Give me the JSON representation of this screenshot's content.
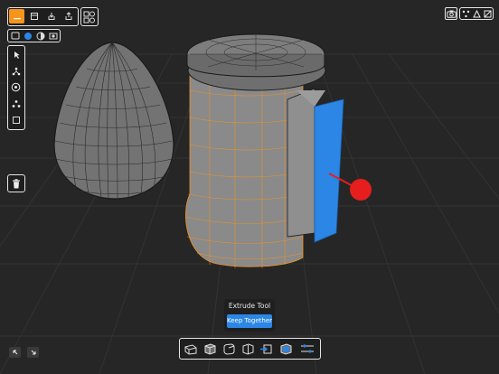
{
  "app": {
    "accent_color": "#f7941d",
    "selection_color": "#2b86e6",
    "marker_color": "#e61e1e"
  },
  "top_left_toolbar": {
    "items": [
      {
        "icon": "menu-icon",
        "active": true
      },
      {
        "icon": "save-icon",
        "active": false
      },
      {
        "icon": "import-icon",
        "active": false
      },
      {
        "icon": "export-icon",
        "active": false
      }
    ],
    "extra": {
      "icon": "shapes-library-icon"
    }
  },
  "view_mode_toolbar": {
    "items": [
      {
        "icon": "wireframe-icon",
        "active": false
      },
      {
        "icon": "shaded-icon",
        "active": true
      },
      {
        "icon": "xray-icon",
        "active": false
      },
      {
        "icon": "camera-view-icon",
        "active": false
      }
    ]
  },
  "selection_toolbar": {
    "items": [
      {
        "icon": "select-arrow-icon"
      },
      {
        "icon": "vertex-select-icon"
      },
      {
        "icon": "rotate-select-icon"
      },
      {
        "icon": "group-select-icon"
      },
      {
        "icon": "box-select-icon"
      }
    ]
  },
  "delete": {
    "icon": "trash-icon"
  },
  "top_right_toolbar": {
    "items": [
      {
        "icon": "screenshot-camera-icon"
      },
      {
        "icon": "vertices-mode-icon"
      },
      {
        "icon": "triangle-mode-icon"
      },
      {
        "icon": "hide-icon"
      }
    ]
  },
  "tooltip": {
    "title": "Extrude Tool",
    "mode": "Keep Together"
  },
  "bottom_toolbar": {
    "items": [
      {
        "icon": "bevel-tool-icon"
      },
      {
        "icon": "cube-tool-icon"
      },
      {
        "icon": "rounded-cube-tool-icon"
      },
      {
        "icon": "loop-cut-tool-icon"
      },
      {
        "icon": "extrude-tool-icon",
        "active": true
      },
      {
        "icon": "inset-tool-icon"
      },
      {
        "icon": "sliders-icon"
      }
    ]
  },
  "bottom_left_buttons": [
    {
      "icon": "undo-icon"
    },
    {
      "icon": "redo-icon"
    }
  ]
}
